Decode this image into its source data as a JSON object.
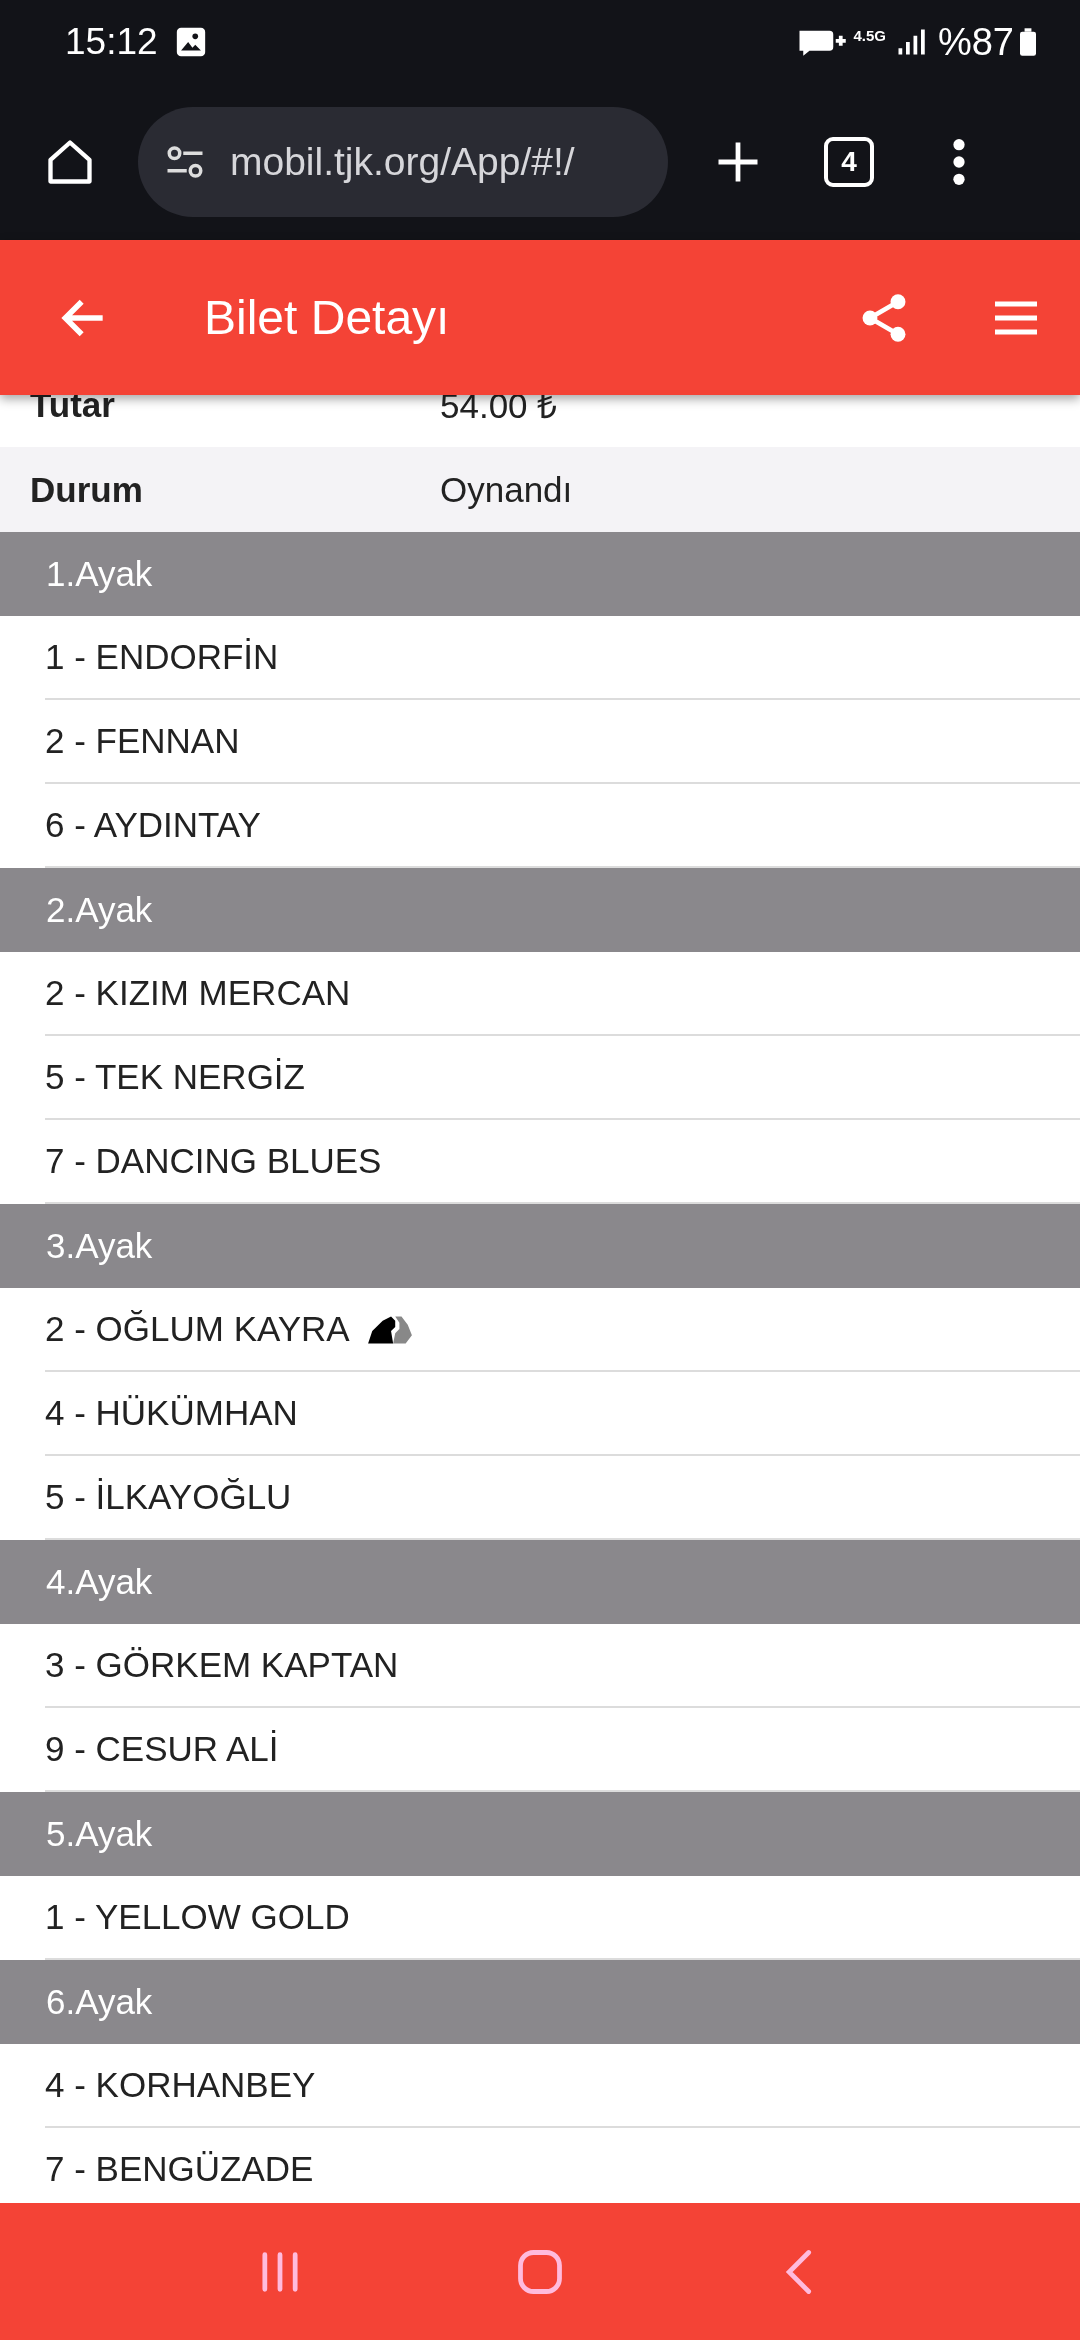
{
  "status_bar": {
    "time": "15:12",
    "network": "4.5G",
    "battery": "%87"
  },
  "browser": {
    "url": "mobil.tjk.org/App/#!/",
    "tab_count": "4"
  },
  "app_bar": {
    "title": "Bilet Detayı"
  },
  "info_rows": [
    {
      "label": "Tutar",
      "value": "54.00 ₺"
    },
    {
      "label": "Durum",
      "value": "Oynandı"
    }
  ],
  "legs": [
    {
      "title": "1.Ayak",
      "horses": [
        {
          "name": "1 - ENDORFİN",
          "has_icon": false
        },
        {
          "name": "2 - FENNAN",
          "has_icon": false
        },
        {
          "name": "6 - AYDINTAY",
          "has_icon": false
        }
      ]
    },
    {
      "title": "2.Ayak",
      "horses": [
        {
          "name": "2 - KIZIM MERCAN",
          "has_icon": false
        },
        {
          "name": "5 - TEK NERGİZ",
          "has_icon": false
        },
        {
          "name": "7 - DANCING BLUES",
          "has_icon": false
        }
      ]
    },
    {
      "title": "3.Ayak",
      "horses": [
        {
          "name": "2 - OĞLUM KAYRA",
          "has_icon": true
        },
        {
          "name": "4 - HÜKÜMHAN",
          "has_icon": false
        },
        {
          "name": "5 - İLKAYOĞLU",
          "has_icon": false
        }
      ]
    },
    {
      "title": "4.Ayak",
      "horses": [
        {
          "name": "3 - GÖRKEM KAPTAN",
          "has_icon": false
        },
        {
          "name": "9 - CESUR ALİ",
          "has_icon": false
        }
      ]
    },
    {
      "title": "5.Ayak",
      "horses": [
        {
          "name": "1 - YELLOW GOLD",
          "has_icon": false
        }
      ]
    },
    {
      "title": "6.Ayak",
      "horses": [
        {
          "name": "4 - KORHANBEY",
          "has_icon": false
        },
        {
          "name": "7 - BENGÜZADE",
          "has_icon": false
        }
      ]
    }
  ]
}
